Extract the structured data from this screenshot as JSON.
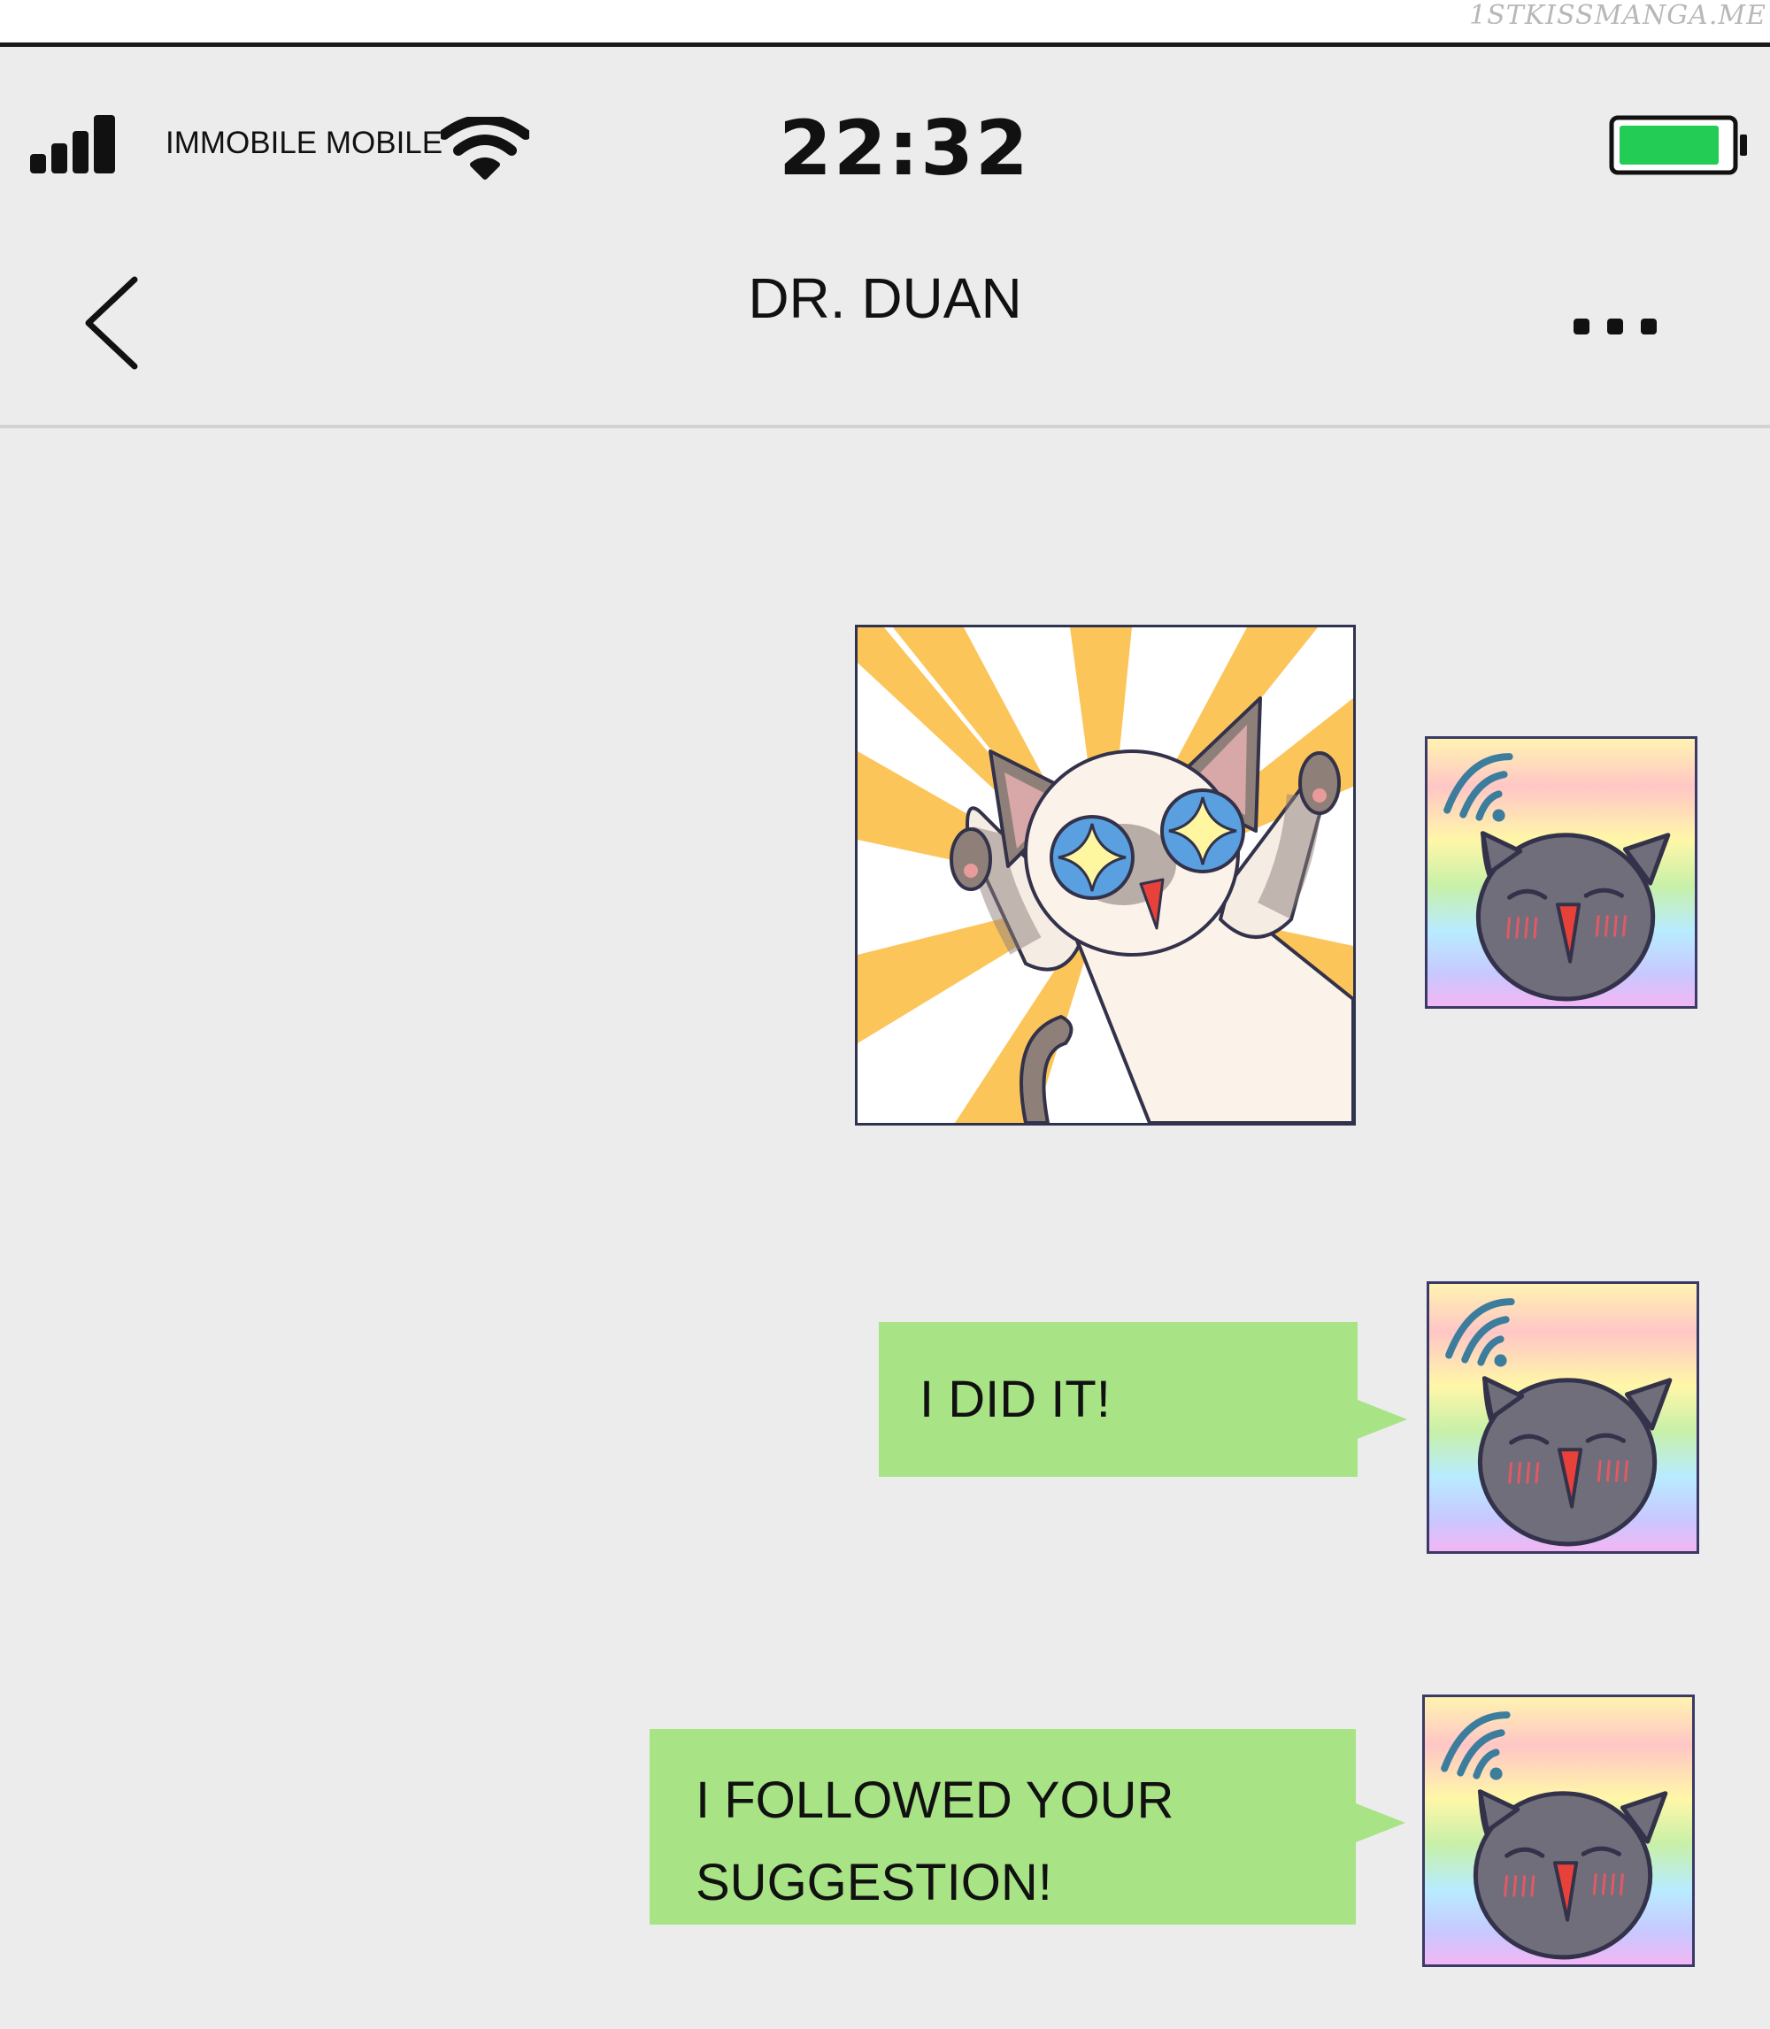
{
  "watermark": "1STKISSMANGA.ME",
  "status_bar": {
    "carrier": "IMMOBILE MOBILE",
    "time": "22:32",
    "signal_icon": "signal-bars-icon",
    "wifi_icon": "wifi-icon",
    "battery_icon": "battery-icon",
    "battery_level": 0.9,
    "battery_color": "#22cc55"
  },
  "header": {
    "title": "DR. DUAN",
    "back_icon": "chevron-left-icon",
    "more_icon": "more-dots-icon"
  },
  "colors": {
    "background": "#ececec",
    "bubble": "#a8e386",
    "sunburst": "#fcc55a"
  },
  "messages": [
    {
      "type": "sticker",
      "sender": "me",
      "sticker": "excited-siamese-cat-sticker"
    },
    {
      "type": "text",
      "sender": "me",
      "line1": "I DID IT!"
    },
    {
      "type": "text",
      "sender": "me",
      "line1": "I FOLLOWED YOUR",
      "line2": "SUGGESTION!"
    }
  ]
}
